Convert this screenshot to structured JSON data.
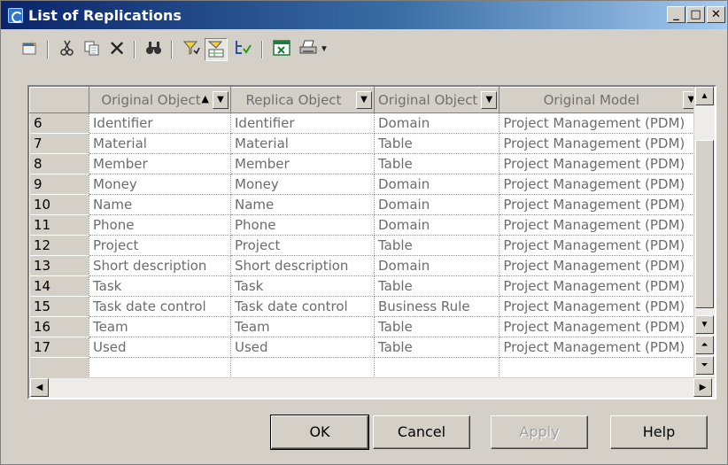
{
  "window": {
    "title": "List of Replications"
  },
  "title_buttons": {
    "minimize": "_",
    "maximize": "□",
    "close": "✕"
  },
  "toolbar": {
    "icons": [
      "properties-icon",
      "cut-icon",
      "copy-icon",
      "delete-icon",
      "find-icon",
      "filter-icon",
      "filter-toggle-icon",
      "column-select-icon",
      "excel-icon",
      "print-icon",
      "print-dropdown-icon"
    ]
  },
  "grid": {
    "columns": [
      "Original Object",
      "Replica Object",
      "Original Object",
      "Original Model"
    ],
    "rows": [
      {
        "num": "6",
        "orig": "Identifier",
        "replica": "Identifier",
        "type": "Domain",
        "model": "Project Management (PDM)"
      },
      {
        "num": "7",
        "orig": "Material",
        "replica": "Material",
        "type": "Table",
        "model": "Project Management (PDM)"
      },
      {
        "num": "8",
        "orig": "Member",
        "replica": "Member",
        "type": "Table",
        "model": "Project Management (PDM)"
      },
      {
        "num": "9",
        "orig": "Money",
        "replica": "Money",
        "type": "Domain",
        "model": "Project Management (PDM)"
      },
      {
        "num": "10",
        "orig": "Name",
        "replica": "Name",
        "type": "Domain",
        "model": "Project Management (PDM)"
      },
      {
        "num": "11",
        "orig": "Phone",
        "replica": "Phone",
        "type": "Domain",
        "model": "Project Management (PDM)"
      },
      {
        "num": "12",
        "orig": "Project",
        "replica": "Project",
        "type": "Table",
        "model": "Project Management (PDM)"
      },
      {
        "num": "13",
        "orig": "Short description",
        "replica": "Short description",
        "type": "Domain",
        "model": "Project Management (PDM)"
      },
      {
        "num": "14",
        "orig": "Task",
        "replica": "Task",
        "type": "Table",
        "model": "Project Management (PDM)"
      },
      {
        "num": "15",
        "orig": "Task date control",
        "replica": "Task date control",
        "type": "Business Rule",
        "model": "Project Management (PDM)"
      },
      {
        "num": "16",
        "orig": "Team",
        "replica": "Team",
        "type": "Table",
        "model": "Project Management (PDM)"
      },
      {
        "num": "17",
        "orig": "Used",
        "replica": "Used",
        "type": "Table",
        "model": "Project Management (PDM)"
      }
    ]
  },
  "buttons": {
    "ok": "OK",
    "cancel": "Cancel",
    "apply": "Apply",
    "help": "Help"
  }
}
